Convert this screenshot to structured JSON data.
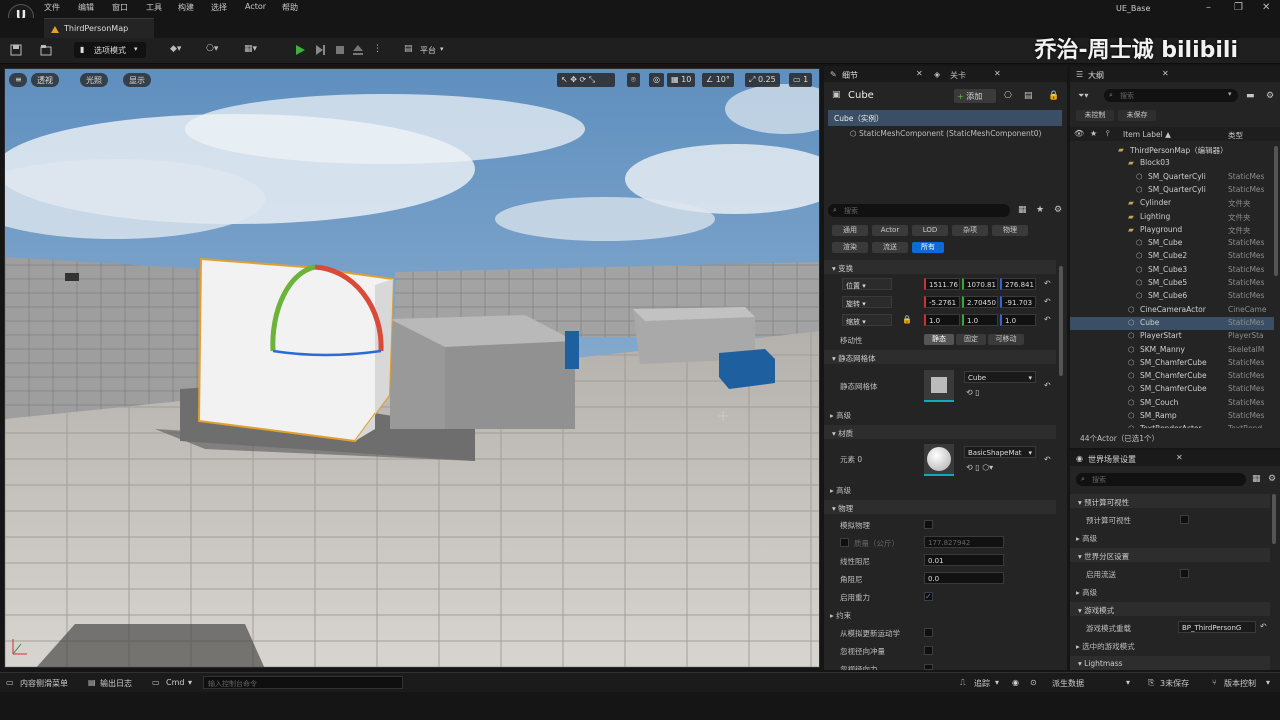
{
  "window": {
    "title": "UE_Base",
    "tab": "ThirdPersonMap",
    "logo": "U",
    "controls": [
      "–",
      "❐",
      "✕"
    ]
  },
  "menu": [
    "文件",
    "编辑",
    "窗口",
    "工具",
    "构建",
    "选择",
    "Actor",
    "帮助"
  ],
  "toolbar": {
    "mode": "选项模式",
    "platform": "平台"
  },
  "watermark": "乔治-周士诚 bilibili",
  "viewport": {
    "perspective": "透视",
    "lit": "光照",
    "show": "显示",
    "grid": "10",
    "angle": "10°",
    "scale": "0.25",
    "camera": "1"
  },
  "details": {
    "tab": "细节",
    "tab2": "关卡",
    "title": "Cube",
    "add": "添加",
    "instance": "Cube（实例）",
    "component": "StaticMeshComponent (StaticMeshComponent0)",
    "search": "搜索",
    "filters": [
      "通用",
      "Actor",
      "LOD",
      "杂项",
      "物理",
      "渲染",
      "流送",
      "所有"
    ],
    "transform": "变换",
    "location": "位置",
    "rotation": "旋转",
    "scale": "缩放",
    "loc": [
      "1511.76",
      "1070.81",
      "276.841"
    ],
    "rot": [
      "-5.2761",
      "2.70450",
      "-91.703"
    ],
    "scl": [
      "1.0",
      "1.0",
      "1.0"
    ],
    "mobility": "移动性",
    "mob_opts": [
      "静态",
      "固定",
      "可移动"
    ],
    "smesh_section": "静态网格体",
    "smesh_label": "静态网格体",
    "smesh_value": "Cube",
    "advanced": "高级",
    "materials": "材质",
    "element": "元素 0",
    "material_value": "BasicShapeMat",
    "physics": "物理",
    "simulate": "模拟物理",
    "mass": "质量（公斤）",
    "mass_value": "177.827942",
    "lin_damp": "线性阻尼",
    "lin_damp_v": "0.01",
    "ang_damp": "角阻尼",
    "ang_damp_v": "0.0",
    "gravity": "启用重力",
    "constraints": "约束",
    "c1": "从模拟更新运动学",
    "c2": "忽视径向冲量",
    "c3": "忽视径向力"
  },
  "outliner": {
    "tab": "大纲",
    "search": "搜索",
    "unsaved1": "未控制",
    "unsaved2": "未保存",
    "col_label": "Item Label ▲",
    "col_type": "类型",
    "rows": [
      {
        "indent": 74,
        "label": "ThirdPersonMap（编辑器）",
        "type": ""
      },
      {
        "indent": 84,
        "label": "Block03",
        "type": ""
      },
      {
        "indent": 92,
        "label": "SM_QuarterCyli",
        "type": "StaticMes"
      },
      {
        "indent": 92,
        "label": "SM_QuarterCyli",
        "type": "StaticMes"
      },
      {
        "indent": 84,
        "label": "Cylinder",
        "type": "文件夹"
      },
      {
        "indent": 84,
        "label": "Lighting",
        "type": "文件夹"
      },
      {
        "indent": 84,
        "label": "Playground",
        "type": "文件夹"
      },
      {
        "indent": 92,
        "label": "SM_Cube",
        "type": "StaticMes"
      },
      {
        "indent": 92,
        "label": "SM_Cube2",
        "type": "StaticMes"
      },
      {
        "indent": 92,
        "label": "SM_Cube3",
        "type": "StaticMes"
      },
      {
        "indent": 92,
        "label": "SM_Cube5",
        "type": "StaticMes"
      },
      {
        "indent": 92,
        "label": "SM_Cube6",
        "type": "StaticMes"
      },
      {
        "indent": 84,
        "label": "CineCameraActor",
        "type": "CineCame"
      },
      {
        "indent": 84,
        "label": "Cube",
        "type": "StaticMes"
      },
      {
        "indent": 84,
        "label": "PlayerStart",
        "type": "PlayerSta"
      },
      {
        "indent": 84,
        "label": "SKM_Manny",
        "type": "SkeletalM"
      },
      {
        "indent": 84,
        "label": "SM_ChamferCube",
        "type": "StaticMes"
      },
      {
        "indent": 84,
        "label": "SM_ChamferCube",
        "type": "StaticMes"
      },
      {
        "indent": 84,
        "label": "SM_ChamferCube",
        "type": "StaticMes"
      },
      {
        "indent": 84,
        "label": "SM_Couch",
        "type": "StaticMes"
      },
      {
        "indent": 84,
        "label": "SM_Ramp",
        "type": "StaticMes"
      },
      {
        "indent": 84,
        "label": "TextRenderActor",
        "type": "TextRend"
      }
    ],
    "count": "44个Actor（已选1个）"
  },
  "world": {
    "tab": "世界场景设置",
    "search": "搜索",
    "s1": "预计算可视性",
    "r1": "预计算可视性",
    "adv1": "高级",
    "s2": "世界分区设置",
    "r2": "启用流送",
    "adv2": "高级",
    "s3": "游戏模式",
    "r3": "游戏模式重载",
    "r3v": "BP_ThirdPersonG",
    "r4": "选中的游戏模式",
    "s4": "Lightmass"
  },
  "status": {
    "drawer": "内容侧滑菜单",
    "log": "输出日志",
    "cmd": "Cmd",
    "cmd_placeholder": "输入控制台命令",
    "trace": "追踪",
    "derived": "派生数据",
    "unsaved": "3未保存",
    "source": "版本控制"
  }
}
